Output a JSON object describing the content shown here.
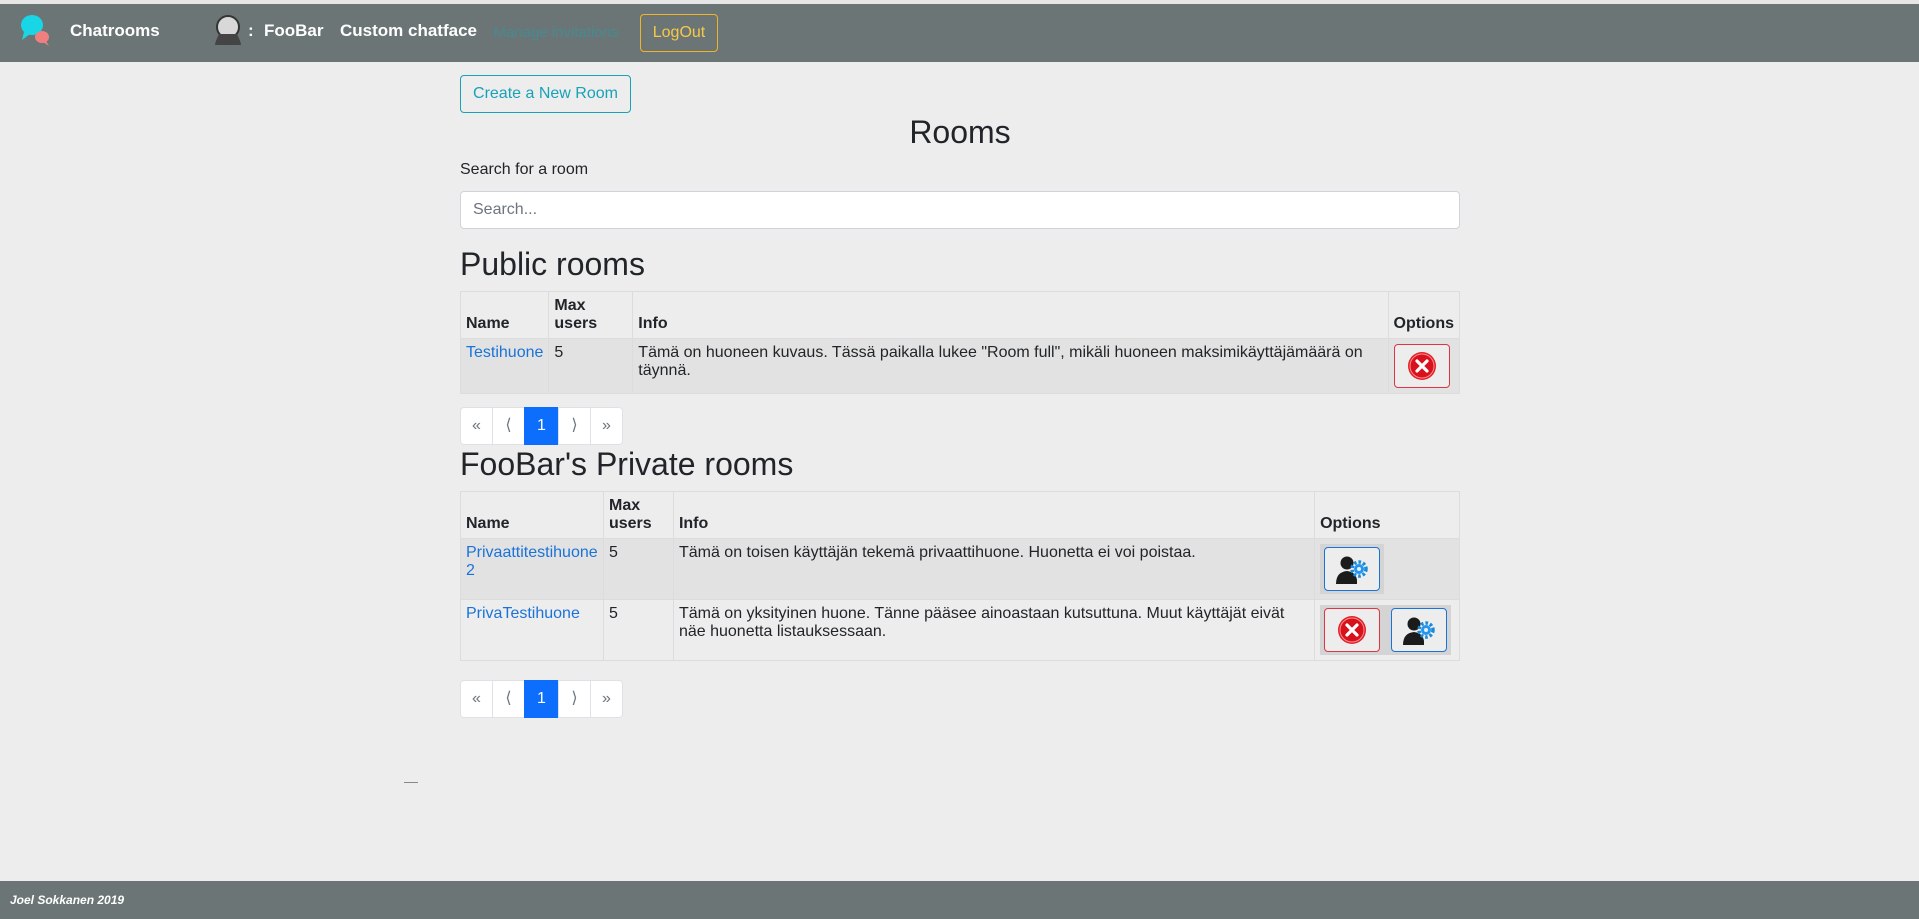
{
  "nav": {
    "brand": "Chatrooms",
    "user_separator": ":",
    "username": "FooBar",
    "custom_chatface": "Custom chatface",
    "disabled_button": "Manage invitations",
    "logout": "LogOut"
  },
  "main": {
    "create_button": "Create a New Room",
    "title": "Rooms",
    "search_label": "Search for a room",
    "search_placeholder": "Search..."
  },
  "public_rooms": {
    "title": "Public rooms",
    "columns": {
      "name": "Name",
      "max_users": "Max users",
      "info": "Info",
      "options": "Options"
    },
    "rows": [
      {
        "name": "Testihuone",
        "max_users": "5",
        "info": "Tämä on huoneen kuvaus. Tässä paikalla lukee \"Room full\", mikäli huoneen maksimikäyttäjämäärä on täynnä."
      }
    ],
    "pagination": {
      "first": "«",
      "prev": "⟨",
      "current": "1",
      "next": "⟩",
      "last": "»"
    }
  },
  "private_rooms": {
    "title": "FooBar's Private rooms",
    "columns": {
      "name": "Name",
      "max_users": "Max users",
      "info": "Info",
      "options": "Options"
    },
    "rows": [
      {
        "name": "Privaattitestihuone 2",
        "max_users": "5",
        "info": "Tämä on toisen käyttäjän tekemä privaattihuone. Huonetta ei voi poistaa."
      },
      {
        "name": "PrivaTestihuone",
        "max_users": "5",
        "info": "Tämä on yksityinen huone. Tänne pääsee ainoastaan kutsuttuna. Muut käyttäjät eivät näe huonetta listauksessaan."
      }
    ],
    "pagination": {
      "first": "«",
      "prev": "⟨",
      "current": "1",
      "next": "⟩",
      "last": "»"
    }
  },
  "footer": {
    "text": "Joel Sokkanen 2019"
  },
  "icons": {
    "brand": "chat-bubbles-icon",
    "user": "user-avatar-icon",
    "delete": "delete-x-icon",
    "manage_users": "user-gear-icon"
  },
  "colors": {
    "navbar": "#6c7575",
    "background": "#ededed",
    "info": "#17a2b8",
    "warning": "#f0b429",
    "danger": "#dc3545",
    "primary": "#0d6efd",
    "link": "#1a73d8"
  }
}
